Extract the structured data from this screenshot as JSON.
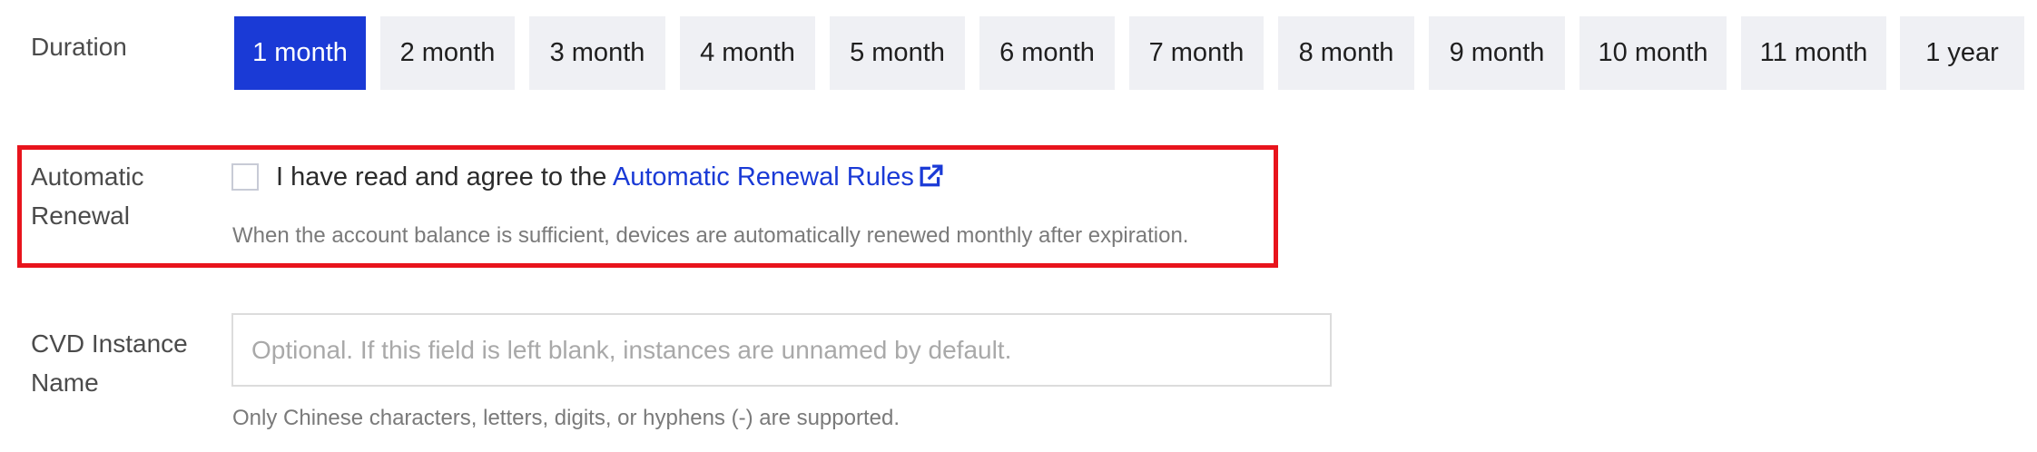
{
  "duration": {
    "label": "Duration",
    "options": [
      "1 month",
      "2 month",
      "3 month",
      "4 month",
      "5 month",
      "6 month",
      "7 month",
      "8 month",
      "9 month",
      "10 month",
      "11 month",
      "1 year"
    ],
    "selected": "1 month"
  },
  "auto_renewal": {
    "label": "Automatic Renewal",
    "checked": false,
    "agree_text": "I have read and agree to the",
    "link_text": "Automatic Renewal Rules",
    "link_icon": "external-link-icon",
    "help": "When the account balance is sufficient, devices are automatically renewed monthly after expiration."
  },
  "instance_name": {
    "label": "CVD Instance Name",
    "value": "",
    "placeholder": "Optional. If this field is left blank, instances are unnamed by default.",
    "help": "Only Chinese characters, letters, digits, or hyphens (-) are supported."
  },
  "colors": {
    "accent": "#1a3ad6",
    "highlight_border": "#e8141c",
    "option_bg": "#eff0f4"
  }
}
